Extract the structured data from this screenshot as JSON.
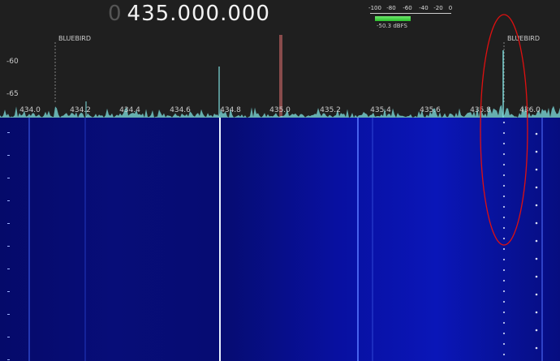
{
  "tuner": {
    "lead_digit": "0",
    "frequency": "435.000.000"
  },
  "level_meter": {
    "ticks": [
      "-100",
      "-80",
      "-60",
      "-40",
      "-20",
      "0"
    ],
    "readout": "-50.3 dBFS",
    "level_fraction": 0.5
  },
  "spectrum": {
    "y_labels": [
      "-60",
      "-65"
    ],
    "x_labels": [
      "434.0",
      "434.2",
      "434.4",
      "434.6",
      "434.8",
      "435.0",
      "435.2",
      "435.4",
      "435.6",
      "435.8",
      "436.0"
    ],
    "bookmarks": [
      "BLUEBIRD",
      "BLUEBIRD"
    ],
    "colors": {
      "trace": "#7fe0e0",
      "tuned_marker": "#e07070",
      "annotation": "#e01010"
    }
  },
  "waterfall": {
    "colors": {
      "base": "#060c72",
      "trace": "#e8f0ff"
    }
  }
}
